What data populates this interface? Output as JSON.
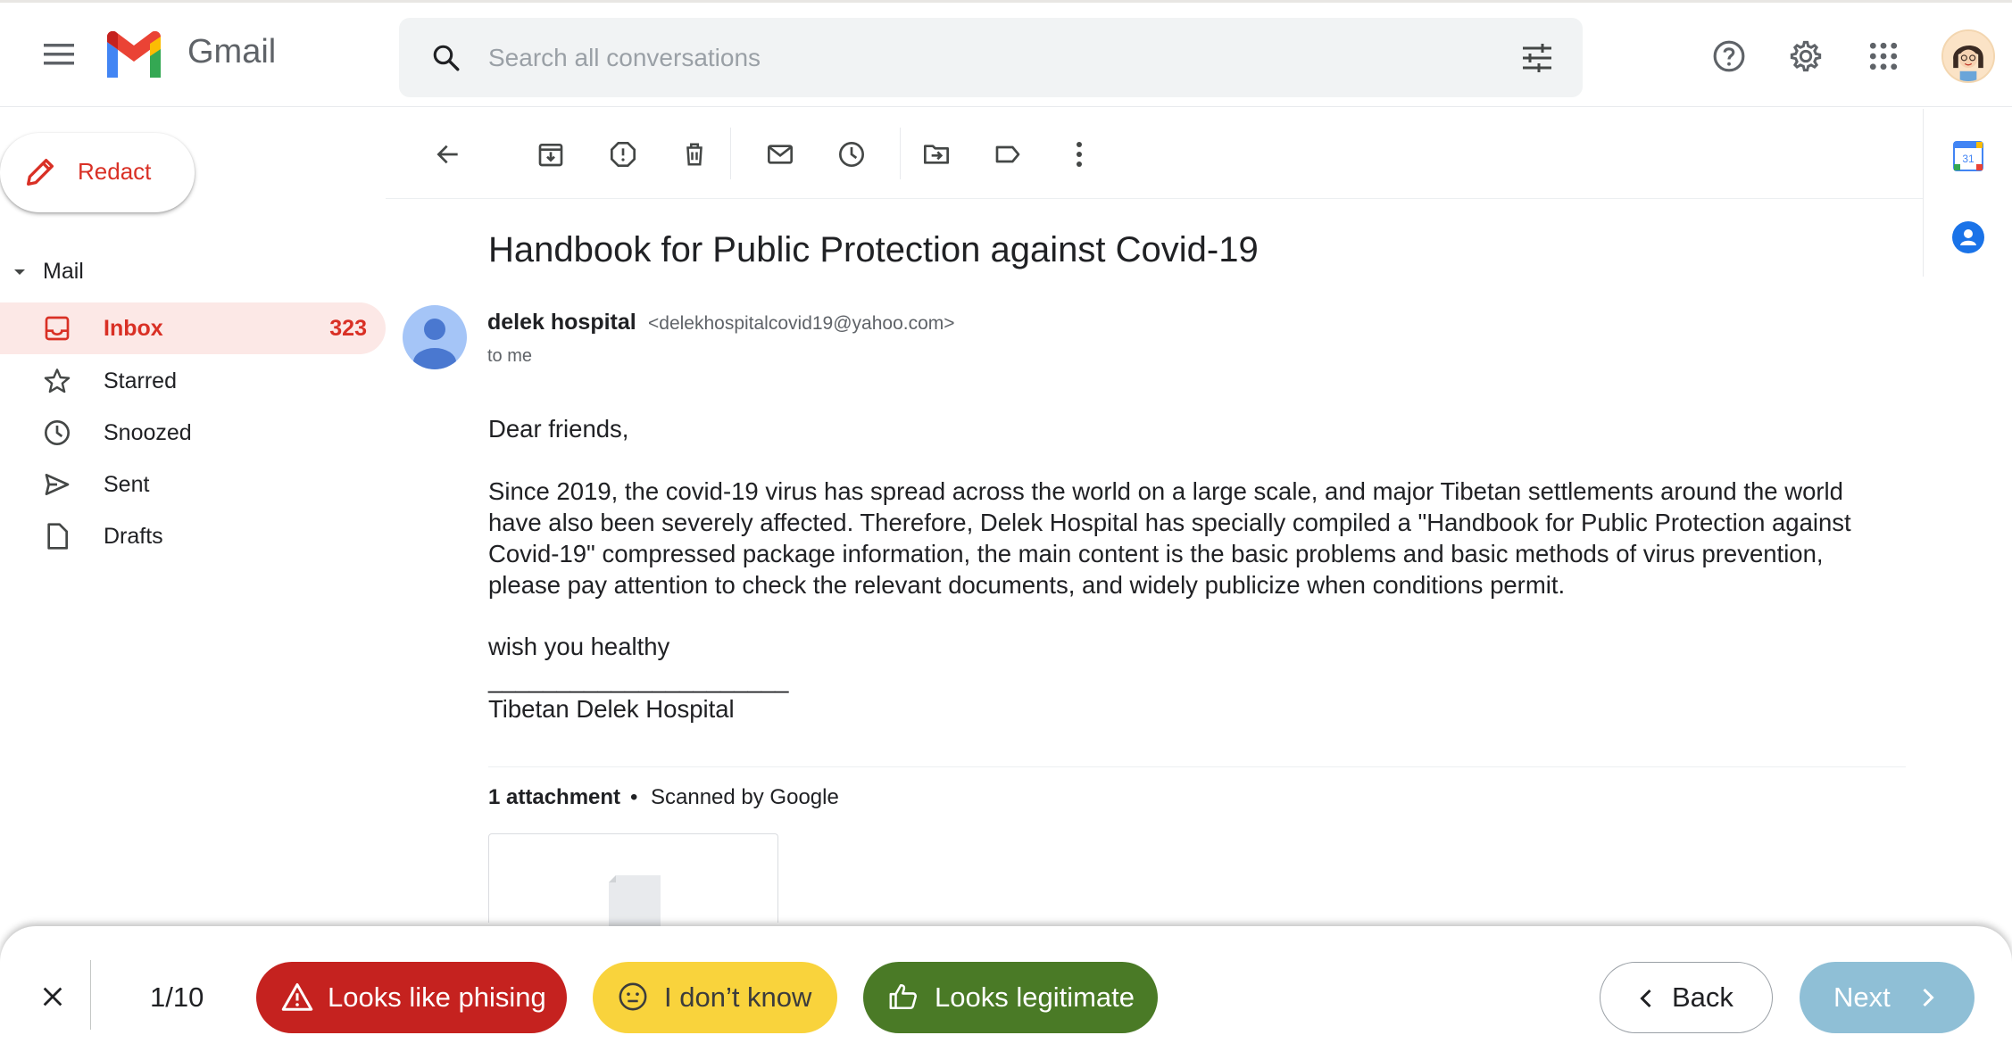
{
  "header": {
    "app_name": "Gmail",
    "search_placeholder": "Search all conversations",
    "icons": [
      "menu-icon",
      "gmail-logo",
      "search-icon",
      "search-options-icon",
      "help-icon",
      "settings-icon",
      "apps-icon",
      "account-avatar"
    ]
  },
  "sidebar": {
    "compose_label": "Redact",
    "section_label": "Mail",
    "items": [
      {
        "label": "Inbox",
        "count": "323",
        "icon": "inbox-icon",
        "active": true
      },
      {
        "label": "Starred",
        "icon": "star-icon"
      },
      {
        "label": "Snoozed",
        "icon": "clock-icon"
      },
      {
        "label": "Sent",
        "icon": "send-icon"
      },
      {
        "label": "Drafts",
        "icon": "draft-icon"
      }
    ]
  },
  "toolbar": {
    "icons": [
      "back-arrow-icon",
      "archive-icon",
      "report-spam-icon",
      "delete-icon",
      "mark-unread-icon",
      "snooze-icon",
      "move-to-icon",
      "label-icon",
      "more-icon"
    ]
  },
  "message": {
    "subject": "Handbook for Public Protection against Covid-19",
    "sender_name": "delek hospital",
    "sender_email": "<delekhospitalcovid19@yahoo.com>",
    "to": "to me",
    "greeting": "Dear friends,",
    "body_lines": [
      "Since 2019, the covid-19 virus has spread across the world on a large scale, and major Tibetan settlements around the world",
      "have also been severely affected. Therefore, Delek Hospital has specially compiled a \"Handbook for Public Protection against",
      "Covid-19\" compressed package information, the main content is the basic problems and basic methods of virus prevention,",
      "please pay attention to check the relevant documents, and widely publicize when conditions permit."
    ],
    "closing": "wish you healthy",
    "signature_rule": "______________________",
    "signature": "Tibetan Delek Hospital",
    "attachments": {
      "count_label": "1 attachment",
      "separator": "•",
      "scanned_label": "Scanned by Google"
    }
  },
  "side_panel": {
    "icons": [
      "calendar-icon",
      "contacts-icon"
    ],
    "calendar_day": "31"
  },
  "training_bar": {
    "progress": "1/10",
    "phishing_label": "Looks like phising",
    "unknown_label": "I don’t know",
    "legit_label": "Looks legitimate",
    "back_label": "Back",
    "next_label": "Next",
    "colors": {
      "phishing": "#c5221f",
      "unknown": "#f9d33c",
      "legit": "#4a7a26",
      "next": "#8fbfd6"
    }
  }
}
